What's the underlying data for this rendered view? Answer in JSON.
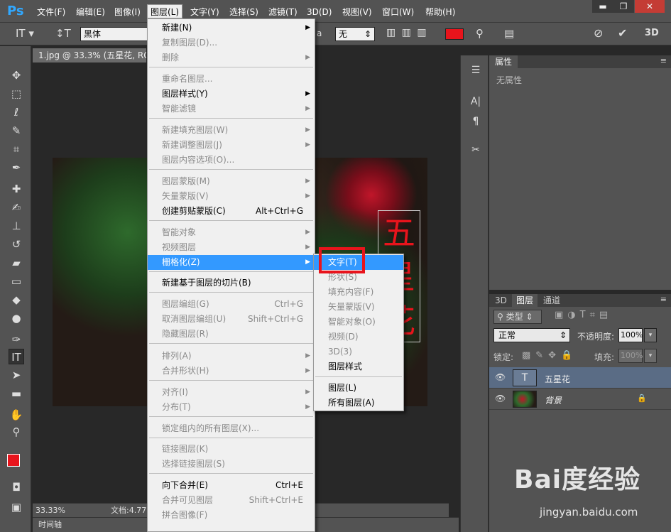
{
  "app": {
    "logo": "Ps"
  },
  "menubar": {
    "items": [
      "文件(F)",
      "编辑(E)",
      "图像(I)",
      "图层(L)",
      "文字(Y)",
      "选择(S)",
      "滤镜(T)",
      "3D(D)",
      "视图(V)",
      "窗口(W)",
      "帮助(H)"
    ],
    "active_index": 3
  },
  "window_controls": {
    "minimize": "▬",
    "restore": "❐",
    "close": "✕"
  },
  "options_bar": {
    "tool_glyph": "T",
    "font_family": "黑体",
    "aa_suffix": "a",
    "antialias": "无",
    "text_color": "#e8141c"
  },
  "document": {
    "tab_title": "1.jpg @ 33.3% (五星花, RGB",
    "zoom": "33.33%",
    "status": "文档:4.77",
    "canvas_text": "五星花",
    "timeline_label": "时间轴"
  },
  "layer_menu": {
    "items": [
      {
        "label": "新建(N)",
        "disabled": false,
        "submenu": true,
        "shortcut": ""
      },
      {
        "label": "复制图层(D)...",
        "disabled": true,
        "submenu": false,
        "shortcut": ""
      },
      {
        "label": "删除",
        "disabled": true,
        "submenu": true,
        "shortcut": ""
      },
      {
        "label": "重命名图层...",
        "disabled": true,
        "submenu": false,
        "shortcut": ""
      },
      {
        "label": "图层样式(Y)",
        "disabled": false,
        "submenu": true,
        "shortcut": ""
      },
      {
        "label": "智能滤镜",
        "disabled": true,
        "submenu": true,
        "shortcut": ""
      },
      {
        "label": "新建填充图层(W)",
        "disabled": true,
        "submenu": true,
        "shortcut": ""
      },
      {
        "label": "新建调整图层(J)",
        "disabled": true,
        "submenu": true,
        "shortcut": ""
      },
      {
        "label": "图层内容选项(O)...",
        "disabled": true,
        "submenu": false,
        "shortcut": ""
      },
      {
        "label": "图层蒙版(M)",
        "disabled": true,
        "submenu": true,
        "shortcut": ""
      },
      {
        "label": "矢量蒙版(V)",
        "disabled": true,
        "submenu": true,
        "shortcut": ""
      },
      {
        "label": "创建剪贴蒙版(C)",
        "disabled": false,
        "submenu": false,
        "shortcut": "Alt+Ctrl+G"
      },
      {
        "label": "智能对象",
        "disabled": true,
        "submenu": true,
        "shortcut": ""
      },
      {
        "label": "视频图层",
        "disabled": true,
        "submenu": true,
        "shortcut": ""
      },
      {
        "label": "栅格化(Z)",
        "disabled": false,
        "submenu": true,
        "shortcut": "",
        "highlighted": true
      },
      {
        "label": "新建基于图层的切片(B)",
        "disabled": false,
        "submenu": false,
        "shortcut": ""
      },
      {
        "label": "图层编组(G)",
        "disabled": true,
        "submenu": false,
        "shortcut": "Ctrl+G"
      },
      {
        "label": "取消图层编组(U)",
        "disabled": true,
        "submenu": false,
        "shortcut": "Shift+Ctrl+G"
      },
      {
        "label": "隐藏图层(R)",
        "disabled": true,
        "submenu": false,
        "shortcut": ""
      },
      {
        "label": "排列(A)",
        "disabled": true,
        "submenu": true,
        "shortcut": ""
      },
      {
        "label": "合并形状(H)",
        "disabled": true,
        "submenu": true,
        "shortcut": ""
      },
      {
        "label": "对齐(I)",
        "disabled": true,
        "submenu": true,
        "shortcut": ""
      },
      {
        "label": "分布(T)",
        "disabled": true,
        "submenu": true,
        "shortcut": ""
      },
      {
        "label": "锁定组内的所有图层(X)...",
        "disabled": true,
        "submenu": false,
        "shortcut": ""
      },
      {
        "label": "链接图层(K)",
        "disabled": true,
        "submenu": false,
        "shortcut": ""
      },
      {
        "label": "选择链接图层(S)",
        "disabled": true,
        "submenu": false,
        "shortcut": ""
      },
      {
        "label": "向下合并(E)",
        "disabled": false,
        "submenu": false,
        "shortcut": "Ctrl+E"
      },
      {
        "label": "合并可见图层",
        "disabled": true,
        "submenu": false,
        "shortcut": "Shift+Ctrl+E"
      },
      {
        "label": "拼合图像(F)",
        "disabled": true,
        "submenu": false,
        "shortcut": ""
      }
    ]
  },
  "rasterize_submenu": {
    "items": [
      {
        "label": "文字(T)",
        "disabled": false,
        "highlighted": true
      },
      {
        "label": "形状(S)",
        "disabled": true
      },
      {
        "label": "填充内容(F)",
        "disabled": true
      },
      {
        "label": "矢量蒙版(V)",
        "disabled": true
      },
      {
        "label": "智能对象(O)",
        "disabled": true
      },
      {
        "label": "视频(D)",
        "disabled": true
      },
      {
        "label": "3D(3)",
        "disabled": true
      },
      {
        "label": "图层样式",
        "disabled": false
      },
      {
        "label": "图层(L)",
        "disabled": false
      },
      {
        "label": "所有图层(A)",
        "disabled": false
      }
    ]
  },
  "properties_panel": {
    "tab": "属性",
    "content": "无属性"
  },
  "layers_panel": {
    "tabs": [
      "3D",
      "图层",
      "通道"
    ],
    "active_tab": 1,
    "filter_label": "类型",
    "blend_mode": "正常",
    "opacity_label": "不透明度:",
    "opacity_value": "100%",
    "lock_label": "锁定:",
    "fill_label": "填充:",
    "fill_value": "100%",
    "layers": [
      {
        "name": "五星花",
        "type": "text",
        "selected": true,
        "thumb_glyph": "T"
      },
      {
        "name": "背景",
        "type": "image",
        "selected": false,
        "locked": true
      }
    ]
  },
  "watermark": {
    "logo_text": "Bai度经验",
    "url": "jingyan.baidu.com"
  }
}
